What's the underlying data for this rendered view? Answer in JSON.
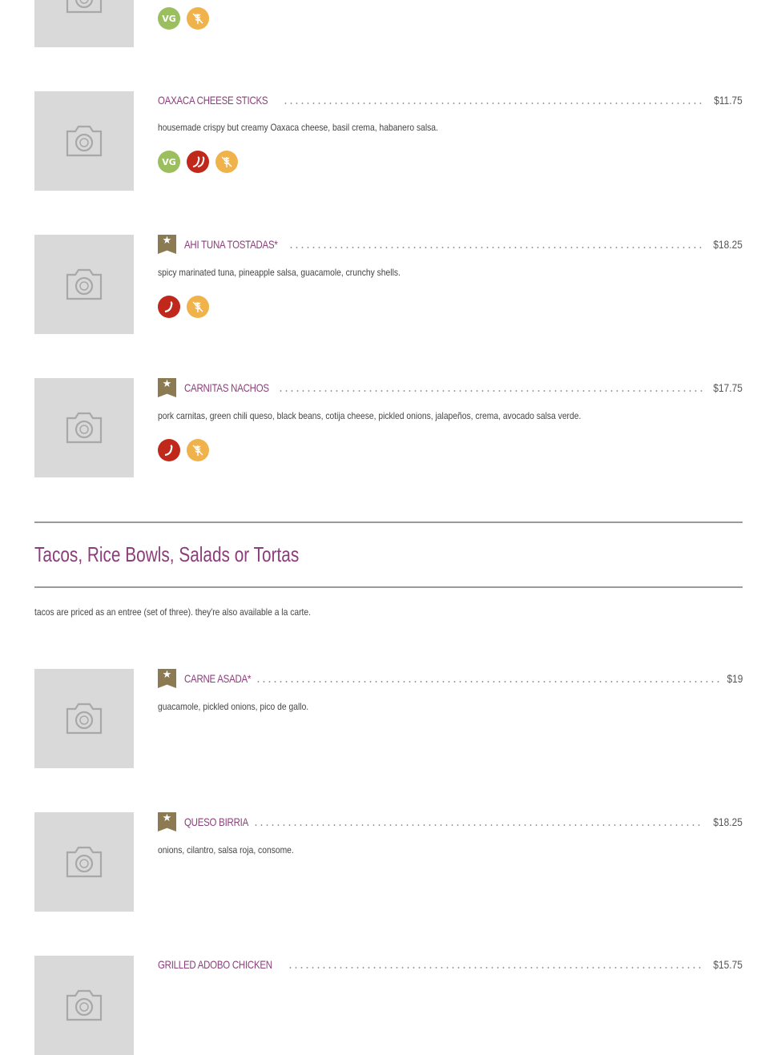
{
  "icons": {
    "vg": "VG",
    "camera": "camera-icon",
    "star": "★",
    "star_icon": "star-icon",
    "hot": "chili-icon",
    "extra_hot": "double-chili-icon",
    "gf": "wheat-crossed-icon"
  },
  "colors": {
    "item_name": "#8a3f7a",
    "star_badge": "#8b7a52",
    "vg_badge": "#9bbf5e",
    "spicy_badge": "#c0281b",
    "gf_badge": "#f0b24a"
  },
  "items": [
    {
      "name": "",
      "price": "",
      "description": "",
      "badges": [
        "vg",
        "gf"
      ]
    },
    {
      "name": "OAXACA CHEESE STICKS",
      "price": "$11.75",
      "description": "housemade crispy but creamy Oaxaca cheese, basil crema, habanero salsa.",
      "badges": [
        "vg",
        "extra_hot",
        "gf"
      ]
    },
    {
      "name": "AHI TUNA TOSTADAS*",
      "price": "$18.25",
      "description": "spicy marinated tuna, pineapple salsa, guacamole, crunchy shells.",
      "featured": true,
      "badges": [
        "hot",
        "gf"
      ]
    },
    {
      "name": "CARNITAS NACHOS",
      "price": "$17.75",
      "description": "pork carnitas, green chili queso, black beans, cotija cheese, pickled onions, jalapeños, crema, avocado salsa verde.",
      "featured": true,
      "badges": [
        "hot",
        "gf"
      ]
    },
    {
      "name": "CARNE ASADA*",
      "price": "$19",
      "description": "guacamole, pickled onions, pico de gallo.",
      "featured": true,
      "badges": []
    },
    {
      "name": "QUESO BIRRIA",
      "price": "$18.25",
      "description": "onions, cilantro, salsa roja, consome.",
      "featured": true,
      "badges": []
    },
    {
      "name": "GRILLED ADOBO CHICKEN",
      "price": "$15.75",
      "description": "",
      "badges": []
    }
  ],
  "section": {
    "title": "Tacos, Rice Bowls, Salads or Tortas",
    "note": "tacos are priced as an entree (set of three). they're also available a la carte."
  }
}
